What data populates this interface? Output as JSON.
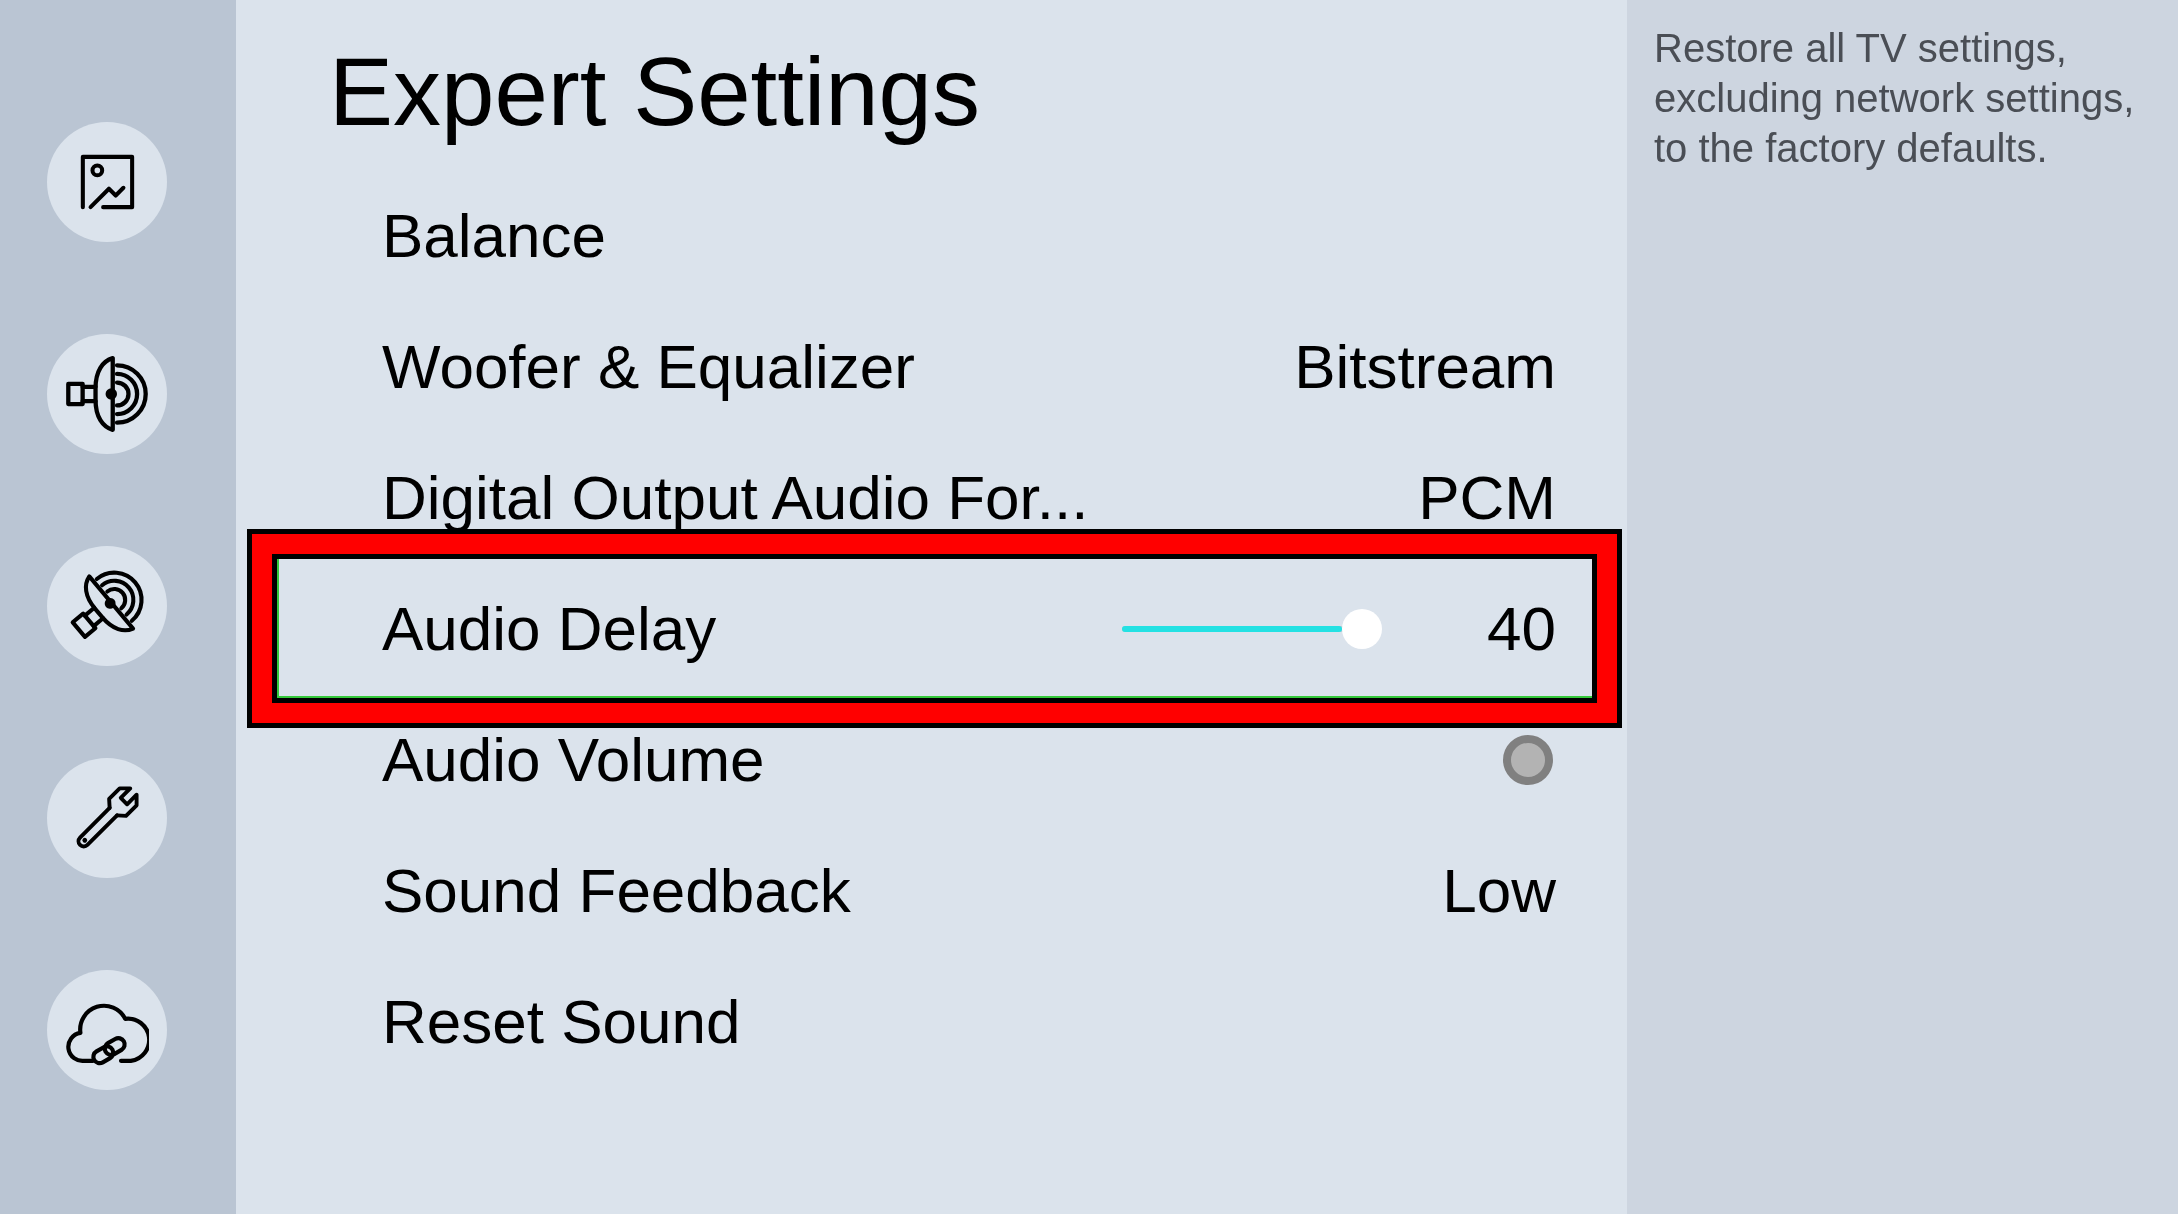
{
  "sidebar": {
    "items": [
      {
        "kind": "image"
      },
      {
        "kind": "speaker"
      },
      {
        "kind": "dish"
      },
      {
        "kind": "wrench"
      },
      {
        "kind": "cloud"
      }
    ]
  },
  "page": {
    "title": "Expert Settings"
  },
  "settings": [
    {
      "kind": "item",
      "label": "Balance",
      "highlighted": false
    },
    {
      "kind": "item",
      "label": "Woofer & Equalizer",
      "value": "Bitstream",
      "highlighted": false
    },
    {
      "kind": "item",
      "label": "Digital Output Audio For...",
      "value": "PCM",
      "highlighted": false
    },
    {
      "kind": "slider",
      "label": "Audio Delay",
      "level": 1,
      "value": "40",
      "highlighted": true
    },
    {
      "kind": "toggle",
      "label": "Audio Volume",
      "on": false,
      "highlighted": false
    },
    {
      "kind": "item",
      "label": "Sound Feedback",
      "value": "Low",
      "highlighted": false
    },
    {
      "kind": "item",
      "label": "Reset Sound",
      "highlighted": false
    }
  ],
  "description": {
    "text": "Restore all TV settings, excluding network settings, to the factory defaults."
  }
}
